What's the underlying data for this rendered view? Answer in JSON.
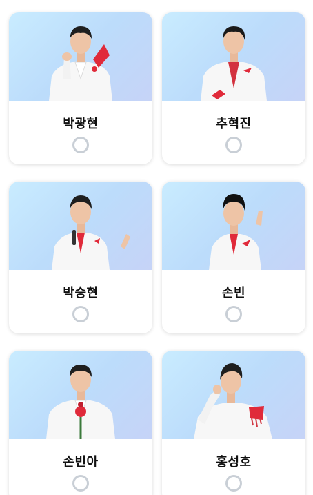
{
  "candidates": [
    {
      "name": "박광현",
      "selected": false
    },
    {
      "name": "추혁진",
      "selected": false
    },
    {
      "name": "박승현",
      "selected": false
    },
    {
      "name": "손빈",
      "selected": false
    },
    {
      "name": "손빈아",
      "selected": false
    },
    {
      "name": "홍성호",
      "selected": false
    }
  ],
  "colors": {
    "photo_bg": "#c2e3fc",
    "suit": "#f7f7f7",
    "accent": "#e02a3a",
    "radio_border": "#c9cfd6"
  }
}
